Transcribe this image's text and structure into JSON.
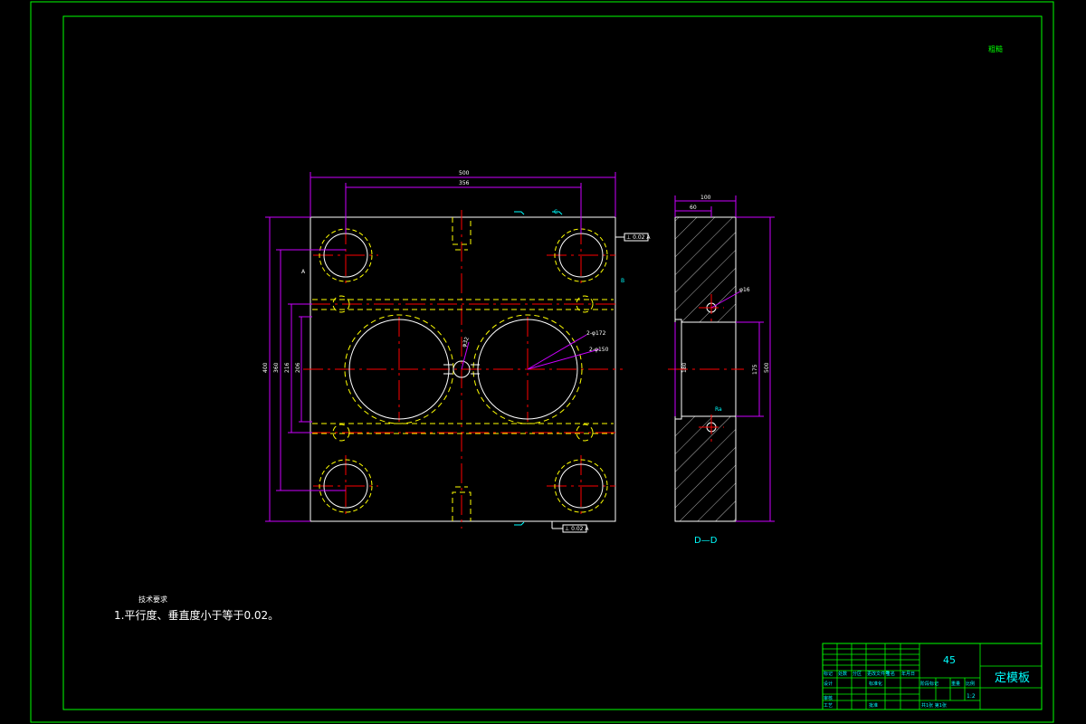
{
  "drawing": {
    "title": "定模板",
    "material": "45",
    "section_label": "D—D",
    "corner_mark": "粗糙",
    "scale": "1:2"
  },
  "front_view": {
    "dims": {
      "overall_width": "500",
      "hole_span_width": "356",
      "overall_height": "400",
      "height_2": "360",
      "height_3": "216",
      "height_4": "206",
      "large_holes": "2-φ172",
      "large_holes_2": "2-φ150",
      "center_hole": "φ32"
    },
    "tolerance_frames": [
      "⊥ 0.02 A",
      "⊥ 0.02 A"
    ],
    "side_notes": [
      "A",
      "B",
      "C"
    ]
  },
  "section_view": {
    "dims": {
      "width": "100",
      "step": "60",
      "hole": "φ16",
      "pocket_height": "180",
      "pocket_height_2": "175",
      "overall_height": "500",
      "roughness": "Ra"
    }
  },
  "tech_requirements": {
    "heading": "技术要求",
    "items": [
      "1.平行度、垂直度小于等于0.02。"
    ]
  },
  "title_block": {
    "left_rows": [
      [
        "标记",
        "处数",
        "分区",
        "更改文件号",
        "签名",
        "年月日"
      ],
      [
        "设计",
        "",
        "",
        "标准化",
        "",
        ""
      ],
      [
        "审核",
        "",
        "",
        "",
        "",
        ""
      ],
      [
        "工艺",
        "",
        "",
        "批准",
        "",
        ""
      ]
    ],
    "mid_headers": [
      "阶段标记",
      "重量",
      "比例"
    ],
    "sheet_info": "共1张  第1张"
  },
  "colors": {
    "frame": "#00ff00",
    "outline": "#ffffff",
    "center": "#ff0000",
    "hidden": "#ffff00",
    "dimension": "#cc00ff",
    "annotation": "#00ffff"
  }
}
